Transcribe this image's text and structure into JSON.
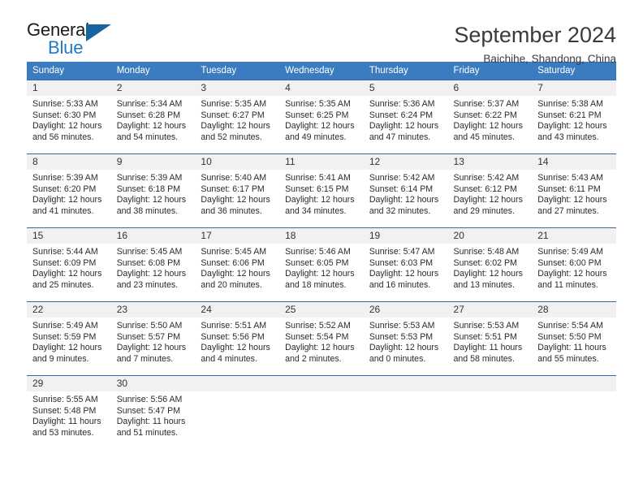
{
  "brand": {
    "name_top": "General",
    "name_bottom": "Blue",
    "triangle_color": "#17659e",
    "blue_text_color": "#1f7ac4"
  },
  "header": {
    "title": "September 2024",
    "subtitle": "Baichihe, Shandong, China"
  },
  "colors": {
    "header_blue": "#3a7cbf",
    "row_rule_blue": "#2f6ca8",
    "daynum_band": "#f1f1f1",
    "text": "#2a2a2a"
  },
  "weekdays": [
    "Sunday",
    "Monday",
    "Tuesday",
    "Wednesday",
    "Thursday",
    "Friday",
    "Saturday"
  ],
  "weeks": [
    [
      {
        "day": "1",
        "sunrise": "Sunrise: 5:33 AM",
        "sunset": "Sunset: 6:30 PM",
        "daylight": "Daylight: 12 hours and 56 minutes."
      },
      {
        "day": "2",
        "sunrise": "Sunrise: 5:34 AM",
        "sunset": "Sunset: 6:28 PM",
        "daylight": "Daylight: 12 hours and 54 minutes."
      },
      {
        "day": "3",
        "sunrise": "Sunrise: 5:35 AM",
        "sunset": "Sunset: 6:27 PM",
        "daylight": "Daylight: 12 hours and 52 minutes."
      },
      {
        "day": "4",
        "sunrise": "Sunrise: 5:35 AM",
        "sunset": "Sunset: 6:25 PM",
        "daylight": "Daylight: 12 hours and 49 minutes."
      },
      {
        "day": "5",
        "sunrise": "Sunrise: 5:36 AM",
        "sunset": "Sunset: 6:24 PM",
        "daylight": "Daylight: 12 hours and 47 minutes."
      },
      {
        "day": "6",
        "sunrise": "Sunrise: 5:37 AM",
        "sunset": "Sunset: 6:22 PM",
        "daylight": "Daylight: 12 hours and 45 minutes."
      },
      {
        "day": "7",
        "sunrise": "Sunrise: 5:38 AM",
        "sunset": "Sunset: 6:21 PM",
        "daylight": "Daylight: 12 hours and 43 minutes."
      }
    ],
    [
      {
        "day": "8",
        "sunrise": "Sunrise: 5:39 AM",
        "sunset": "Sunset: 6:20 PM",
        "daylight": "Daylight: 12 hours and 41 minutes."
      },
      {
        "day": "9",
        "sunrise": "Sunrise: 5:39 AM",
        "sunset": "Sunset: 6:18 PM",
        "daylight": "Daylight: 12 hours and 38 minutes."
      },
      {
        "day": "10",
        "sunrise": "Sunrise: 5:40 AM",
        "sunset": "Sunset: 6:17 PM",
        "daylight": "Daylight: 12 hours and 36 minutes."
      },
      {
        "day": "11",
        "sunrise": "Sunrise: 5:41 AM",
        "sunset": "Sunset: 6:15 PM",
        "daylight": "Daylight: 12 hours and 34 minutes."
      },
      {
        "day": "12",
        "sunrise": "Sunrise: 5:42 AM",
        "sunset": "Sunset: 6:14 PM",
        "daylight": "Daylight: 12 hours and 32 minutes."
      },
      {
        "day": "13",
        "sunrise": "Sunrise: 5:42 AM",
        "sunset": "Sunset: 6:12 PM",
        "daylight": "Daylight: 12 hours and 29 minutes."
      },
      {
        "day": "14",
        "sunrise": "Sunrise: 5:43 AM",
        "sunset": "Sunset: 6:11 PM",
        "daylight": "Daylight: 12 hours and 27 minutes."
      }
    ],
    [
      {
        "day": "15",
        "sunrise": "Sunrise: 5:44 AM",
        "sunset": "Sunset: 6:09 PM",
        "daylight": "Daylight: 12 hours and 25 minutes."
      },
      {
        "day": "16",
        "sunrise": "Sunrise: 5:45 AM",
        "sunset": "Sunset: 6:08 PM",
        "daylight": "Daylight: 12 hours and 23 minutes."
      },
      {
        "day": "17",
        "sunrise": "Sunrise: 5:45 AM",
        "sunset": "Sunset: 6:06 PM",
        "daylight": "Daylight: 12 hours and 20 minutes."
      },
      {
        "day": "18",
        "sunrise": "Sunrise: 5:46 AM",
        "sunset": "Sunset: 6:05 PM",
        "daylight": "Daylight: 12 hours and 18 minutes."
      },
      {
        "day": "19",
        "sunrise": "Sunrise: 5:47 AM",
        "sunset": "Sunset: 6:03 PM",
        "daylight": "Daylight: 12 hours and 16 minutes."
      },
      {
        "day": "20",
        "sunrise": "Sunrise: 5:48 AM",
        "sunset": "Sunset: 6:02 PM",
        "daylight": "Daylight: 12 hours and 13 minutes."
      },
      {
        "day": "21",
        "sunrise": "Sunrise: 5:49 AM",
        "sunset": "Sunset: 6:00 PM",
        "daylight": "Daylight: 12 hours and 11 minutes."
      }
    ],
    [
      {
        "day": "22",
        "sunrise": "Sunrise: 5:49 AM",
        "sunset": "Sunset: 5:59 PM",
        "daylight": "Daylight: 12 hours and 9 minutes."
      },
      {
        "day": "23",
        "sunrise": "Sunrise: 5:50 AM",
        "sunset": "Sunset: 5:57 PM",
        "daylight": "Daylight: 12 hours and 7 minutes."
      },
      {
        "day": "24",
        "sunrise": "Sunrise: 5:51 AM",
        "sunset": "Sunset: 5:56 PM",
        "daylight": "Daylight: 12 hours and 4 minutes."
      },
      {
        "day": "25",
        "sunrise": "Sunrise: 5:52 AM",
        "sunset": "Sunset: 5:54 PM",
        "daylight": "Daylight: 12 hours and 2 minutes."
      },
      {
        "day": "26",
        "sunrise": "Sunrise: 5:53 AM",
        "sunset": "Sunset: 5:53 PM",
        "daylight": "Daylight: 12 hours and 0 minutes."
      },
      {
        "day": "27",
        "sunrise": "Sunrise: 5:53 AM",
        "sunset": "Sunset: 5:51 PM",
        "daylight": "Daylight: 11 hours and 58 minutes."
      },
      {
        "day": "28",
        "sunrise": "Sunrise: 5:54 AM",
        "sunset": "Sunset: 5:50 PM",
        "daylight": "Daylight: 11 hours and 55 minutes."
      }
    ],
    [
      {
        "day": "29",
        "sunrise": "Sunrise: 5:55 AM",
        "sunset": "Sunset: 5:48 PM",
        "daylight": "Daylight: 11 hours and 53 minutes."
      },
      {
        "day": "30",
        "sunrise": "Sunrise: 5:56 AM",
        "sunset": "Sunset: 5:47 PM",
        "daylight": "Daylight: 11 hours and 51 minutes."
      },
      {
        "day": "",
        "sunrise": "",
        "sunset": "",
        "daylight": ""
      },
      {
        "day": "",
        "sunrise": "",
        "sunset": "",
        "daylight": ""
      },
      {
        "day": "",
        "sunrise": "",
        "sunset": "",
        "daylight": ""
      },
      {
        "day": "",
        "sunrise": "",
        "sunset": "",
        "daylight": ""
      },
      {
        "day": "",
        "sunrise": "",
        "sunset": "",
        "daylight": ""
      }
    ]
  ]
}
